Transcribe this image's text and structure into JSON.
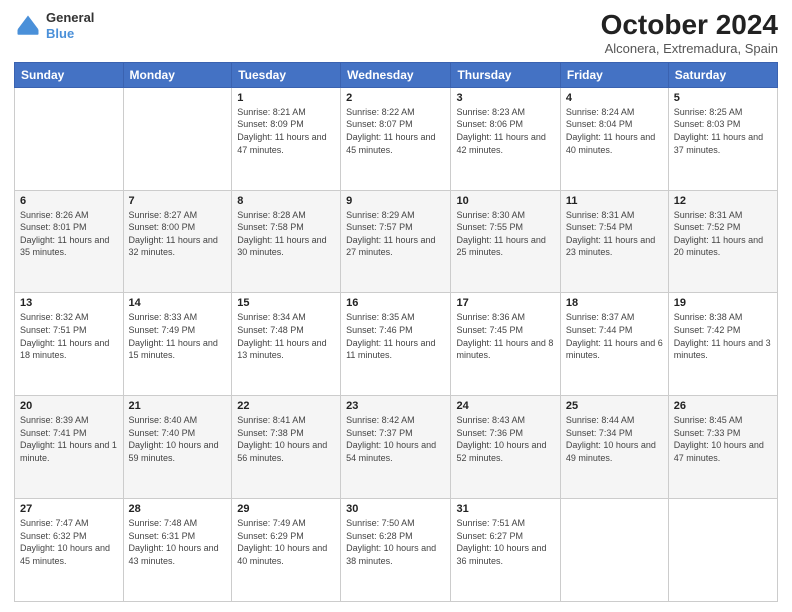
{
  "header": {
    "logo": {
      "general": "General",
      "blue": "Blue"
    },
    "title": "October 2024",
    "location": "Alconera, Extremadura, Spain"
  },
  "calendar": {
    "days_of_week": [
      "Sunday",
      "Monday",
      "Tuesday",
      "Wednesday",
      "Thursday",
      "Friday",
      "Saturday"
    ],
    "weeks": [
      [
        {
          "day": "",
          "info": ""
        },
        {
          "day": "",
          "info": ""
        },
        {
          "day": "1",
          "info": "Sunrise: 8:21 AM\nSunset: 8:09 PM\nDaylight: 11 hours and 47 minutes."
        },
        {
          "day": "2",
          "info": "Sunrise: 8:22 AM\nSunset: 8:07 PM\nDaylight: 11 hours and 45 minutes."
        },
        {
          "day": "3",
          "info": "Sunrise: 8:23 AM\nSunset: 8:06 PM\nDaylight: 11 hours and 42 minutes."
        },
        {
          "day": "4",
          "info": "Sunrise: 8:24 AM\nSunset: 8:04 PM\nDaylight: 11 hours and 40 minutes."
        },
        {
          "day": "5",
          "info": "Sunrise: 8:25 AM\nSunset: 8:03 PM\nDaylight: 11 hours and 37 minutes."
        }
      ],
      [
        {
          "day": "6",
          "info": "Sunrise: 8:26 AM\nSunset: 8:01 PM\nDaylight: 11 hours and 35 minutes."
        },
        {
          "day": "7",
          "info": "Sunrise: 8:27 AM\nSunset: 8:00 PM\nDaylight: 11 hours and 32 minutes."
        },
        {
          "day": "8",
          "info": "Sunrise: 8:28 AM\nSunset: 7:58 PM\nDaylight: 11 hours and 30 minutes."
        },
        {
          "day": "9",
          "info": "Sunrise: 8:29 AM\nSunset: 7:57 PM\nDaylight: 11 hours and 27 minutes."
        },
        {
          "day": "10",
          "info": "Sunrise: 8:30 AM\nSunset: 7:55 PM\nDaylight: 11 hours and 25 minutes."
        },
        {
          "day": "11",
          "info": "Sunrise: 8:31 AM\nSunset: 7:54 PM\nDaylight: 11 hours and 23 minutes."
        },
        {
          "day": "12",
          "info": "Sunrise: 8:31 AM\nSunset: 7:52 PM\nDaylight: 11 hours and 20 minutes."
        }
      ],
      [
        {
          "day": "13",
          "info": "Sunrise: 8:32 AM\nSunset: 7:51 PM\nDaylight: 11 hours and 18 minutes."
        },
        {
          "day": "14",
          "info": "Sunrise: 8:33 AM\nSunset: 7:49 PM\nDaylight: 11 hours and 15 minutes."
        },
        {
          "day": "15",
          "info": "Sunrise: 8:34 AM\nSunset: 7:48 PM\nDaylight: 11 hours and 13 minutes."
        },
        {
          "day": "16",
          "info": "Sunrise: 8:35 AM\nSunset: 7:46 PM\nDaylight: 11 hours and 11 minutes."
        },
        {
          "day": "17",
          "info": "Sunrise: 8:36 AM\nSunset: 7:45 PM\nDaylight: 11 hours and 8 minutes."
        },
        {
          "day": "18",
          "info": "Sunrise: 8:37 AM\nSunset: 7:44 PM\nDaylight: 11 hours and 6 minutes."
        },
        {
          "day": "19",
          "info": "Sunrise: 8:38 AM\nSunset: 7:42 PM\nDaylight: 11 hours and 3 minutes."
        }
      ],
      [
        {
          "day": "20",
          "info": "Sunrise: 8:39 AM\nSunset: 7:41 PM\nDaylight: 11 hours and 1 minute."
        },
        {
          "day": "21",
          "info": "Sunrise: 8:40 AM\nSunset: 7:40 PM\nDaylight: 10 hours and 59 minutes."
        },
        {
          "day": "22",
          "info": "Sunrise: 8:41 AM\nSunset: 7:38 PM\nDaylight: 10 hours and 56 minutes."
        },
        {
          "day": "23",
          "info": "Sunrise: 8:42 AM\nSunset: 7:37 PM\nDaylight: 10 hours and 54 minutes."
        },
        {
          "day": "24",
          "info": "Sunrise: 8:43 AM\nSunset: 7:36 PM\nDaylight: 10 hours and 52 minutes."
        },
        {
          "day": "25",
          "info": "Sunrise: 8:44 AM\nSunset: 7:34 PM\nDaylight: 10 hours and 49 minutes."
        },
        {
          "day": "26",
          "info": "Sunrise: 8:45 AM\nSunset: 7:33 PM\nDaylight: 10 hours and 47 minutes."
        }
      ],
      [
        {
          "day": "27",
          "info": "Sunrise: 7:47 AM\nSunset: 6:32 PM\nDaylight: 10 hours and 45 minutes."
        },
        {
          "day": "28",
          "info": "Sunrise: 7:48 AM\nSunset: 6:31 PM\nDaylight: 10 hours and 43 minutes."
        },
        {
          "day": "29",
          "info": "Sunrise: 7:49 AM\nSunset: 6:29 PM\nDaylight: 10 hours and 40 minutes."
        },
        {
          "day": "30",
          "info": "Sunrise: 7:50 AM\nSunset: 6:28 PM\nDaylight: 10 hours and 38 minutes."
        },
        {
          "day": "31",
          "info": "Sunrise: 7:51 AM\nSunset: 6:27 PM\nDaylight: 10 hours and 36 minutes."
        },
        {
          "day": "",
          "info": ""
        },
        {
          "day": "",
          "info": ""
        }
      ]
    ]
  }
}
